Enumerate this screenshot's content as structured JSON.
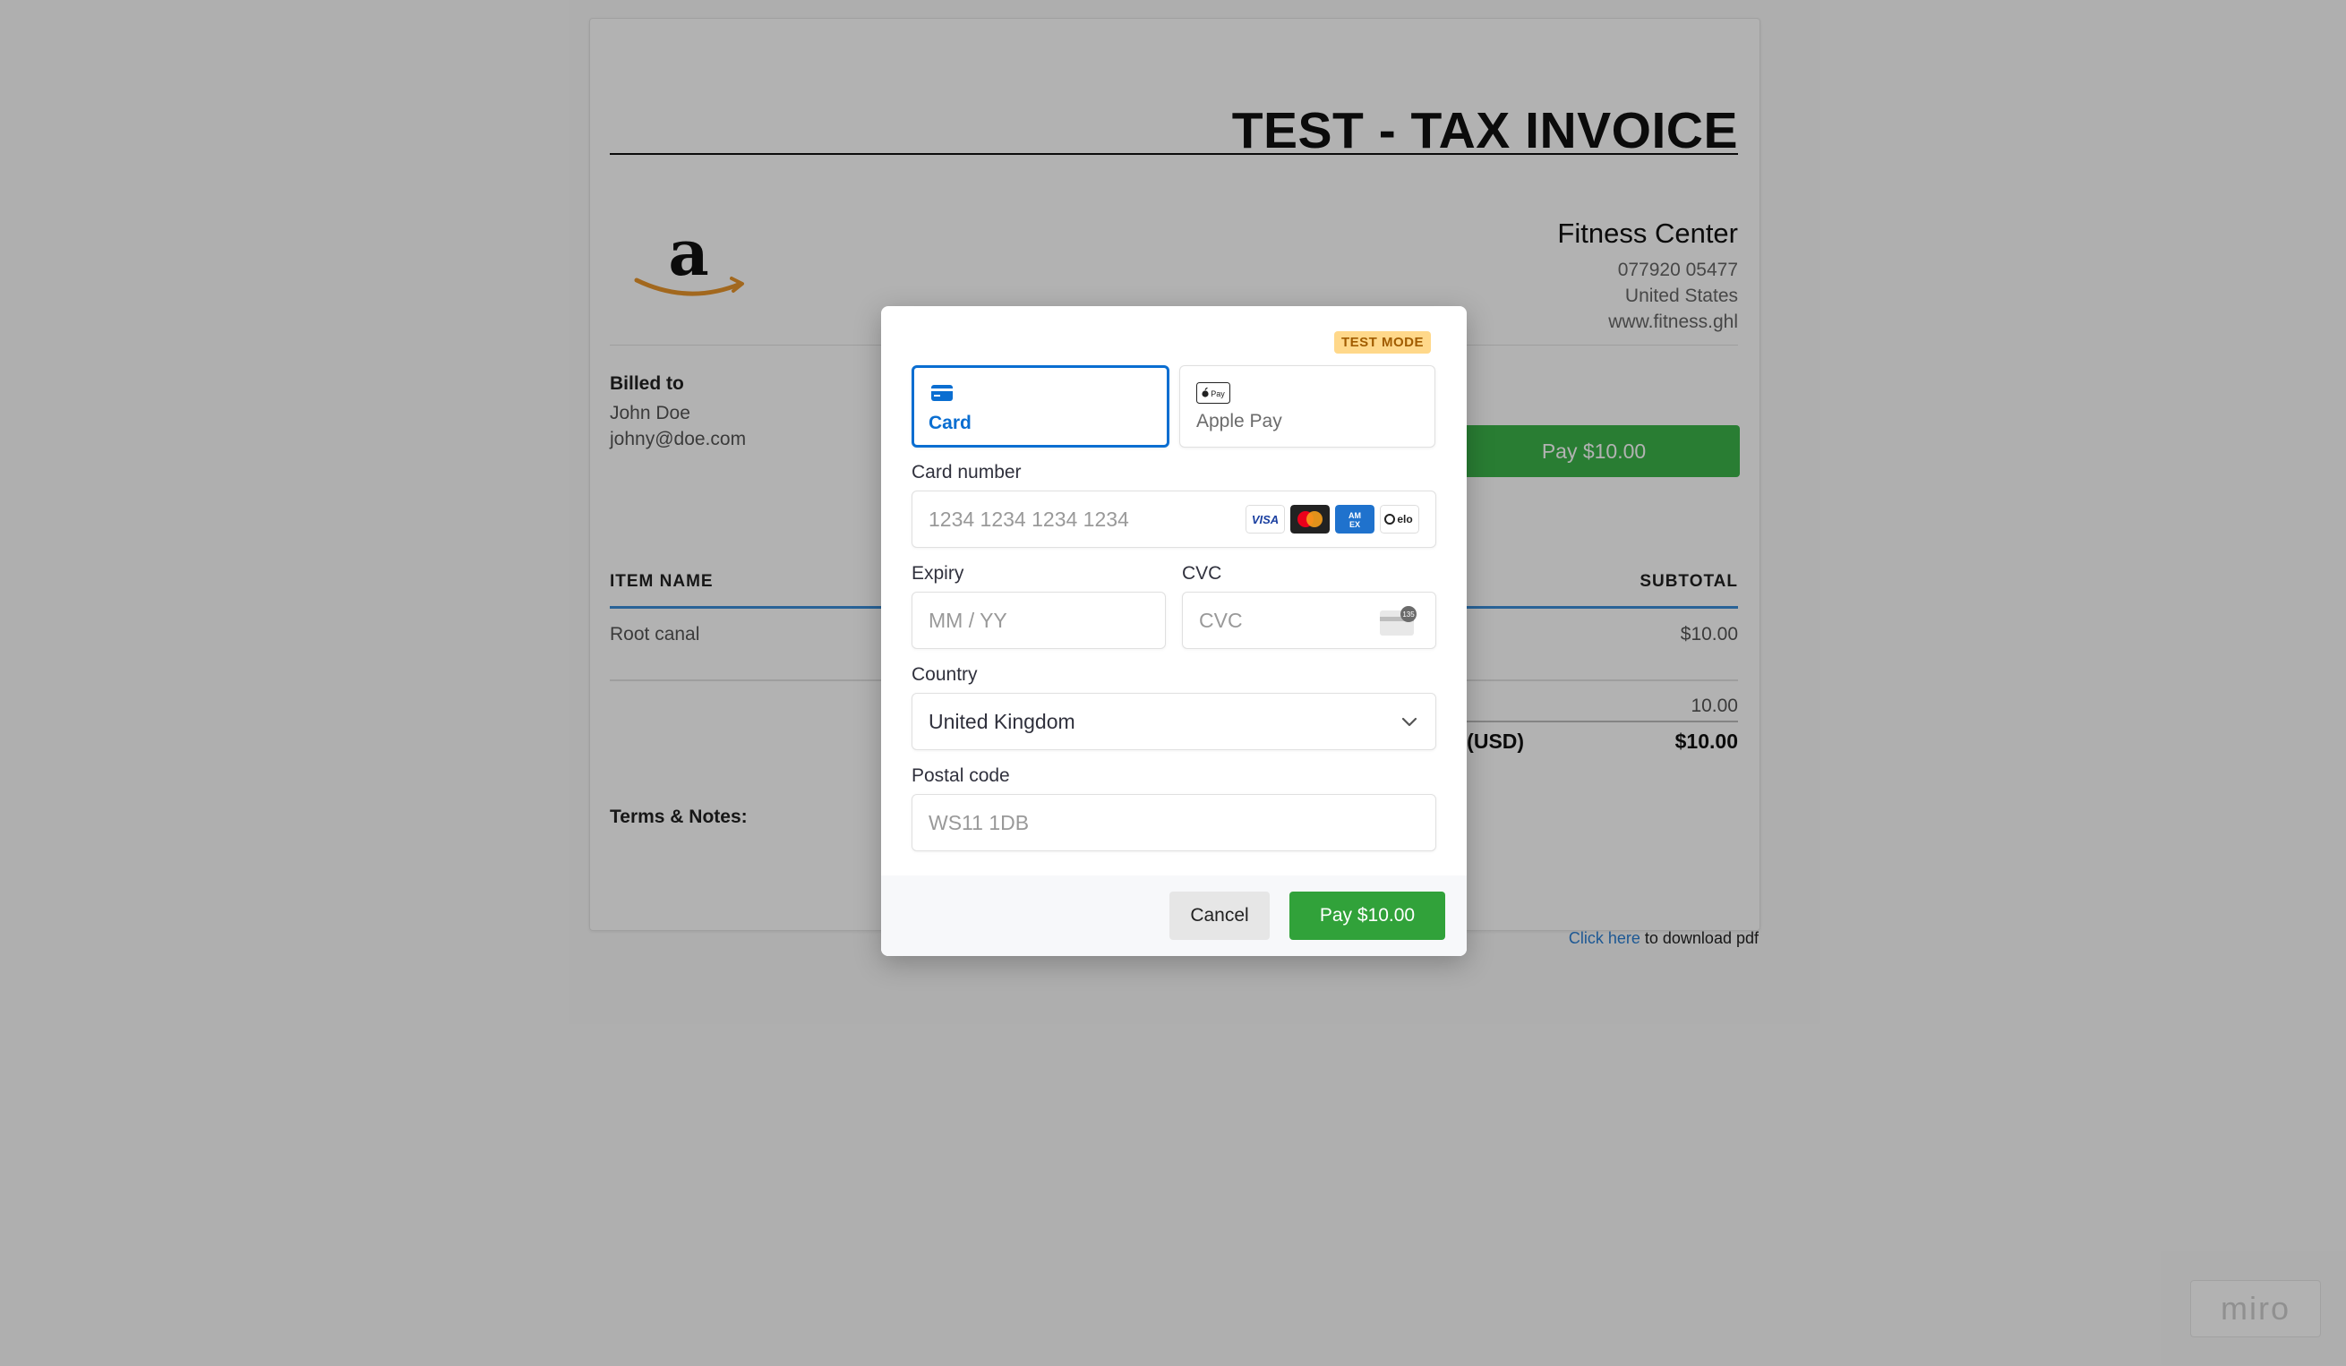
{
  "invoice": {
    "title": "TEST - TAX INVOICE",
    "company": {
      "name": "Fitness Center",
      "phone": "077920 05477",
      "country": "United States",
      "website": "www.fitness.ghl"
    },
    "billed_to": {
      "label": "Billed to",
      "name": "John Doe",
      "email": "johny@doe.com"
    },
    "pay_button": "Pay $10.00",
    "table": {
      "headers": {
        "item_name": "ITEM NAME",
        "subtotal": "SUBTOTAL"
      },
      "rows": [
        {
          "item": "Root canal",
          "subtotal": "$10.00"
        }
      ]
    },
    "totals": {
      "sub_value": "10.00",
      "amount_due_label_partial": "e (USD)",
      "amount_due_value": "$10.00"
    },
    "terms_label": "Terms & Notes:",
    "download": {
      "link_text": "Click here",
      "suffix": " to download pdf"
    }
  },
  "watermark": "miro",
  "payment_modal": {
    "badge": "TEST MODE",
    "tabs": [
      {
        "label": "Card",
        "icon": "card-icon",
        "selected": true
      },
      {
        "label": "Apple Pay",
        "icon": "apple-pay-icon",
        "selected": false
      }
    ],
    "card_number": {
      "label": "Card number",
      "placeholder": "1234 1234 1234 1234"
    },
    "card_brands": [
      "VISA",
      "mastercard",
      "amex",
      "elo"
    ],
    "expiry": {
      "label": "Expiry",
      "placeholder": "MM / YY"
    },
    "cvc": {
      "label": "CVC",
      "placeholder": "CVC",
      "icon_text": "135"
    },
    "country": {
      "label": "Country",
      "value": "United Kingdom"
    },
    "postal": {
      "label": "Postal code",
      "placeholder": "WS11 1DB"
    },
    "buttons": {
      "cancel": "Cancel",
      "pay": "Pay $10.00"
    }
  },
  "colors": {
    "accent_blue": "#0a6ed1",
    "pay_green": "#31a23a",
    "badge_bg": "#ffd88a",
    "table_rule": "#3b8ed9"
  }
}
